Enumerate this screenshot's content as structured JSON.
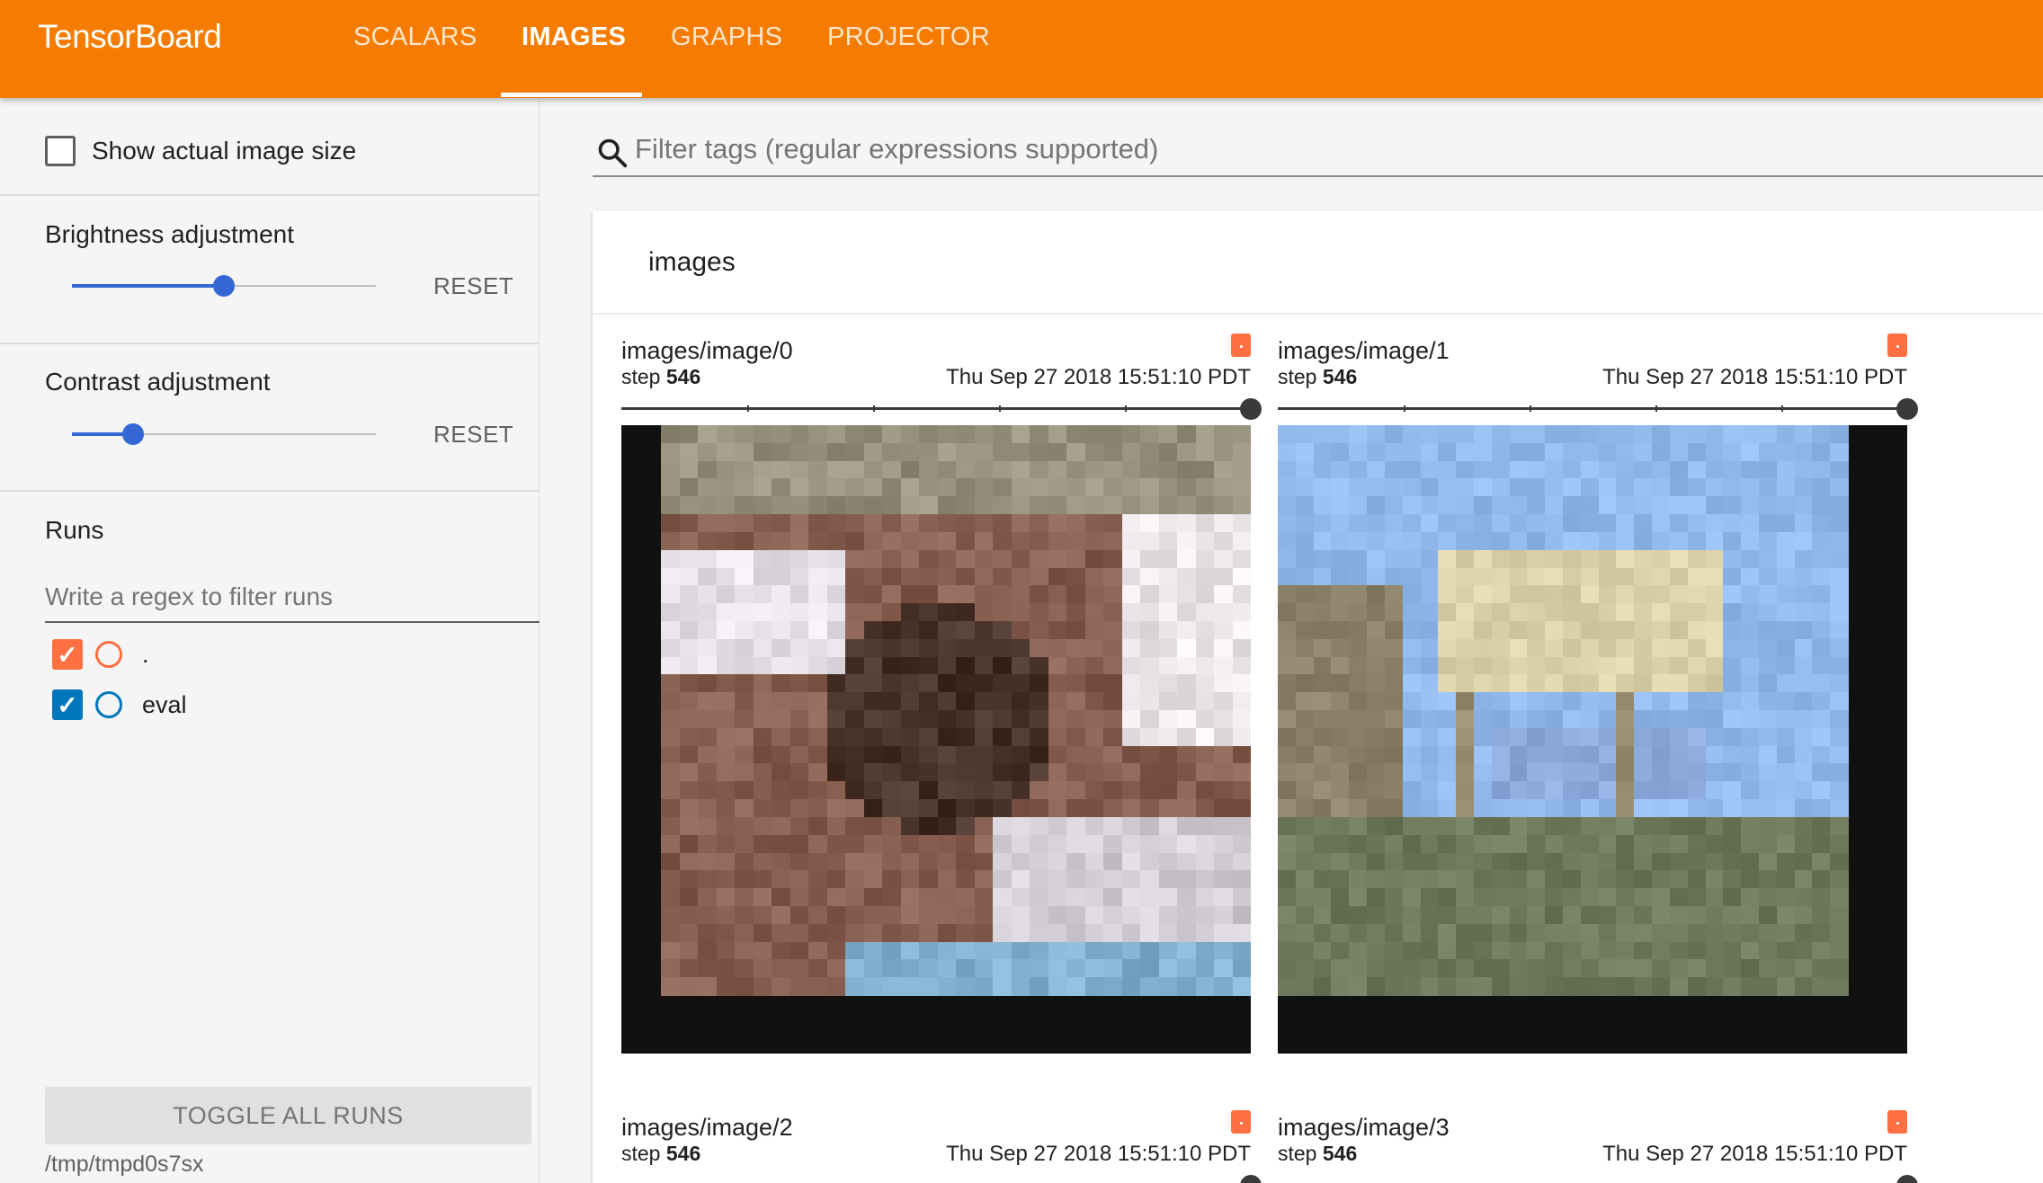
{
  "header": {
    "brand": "TensorBoard",
    "tabs": [
      {
        "label": "SCALARS",
        "active": false
      },
      {
        "label": "IMAGES",
        "active": true
      },
      {
        "label": "GRAPHS",
        "active": false
      },
      {
        "label": "PROJECTOR",
        "active": false
      }
    ],
    "color": "#f57c00"
  },
  "sidebar": {
    "show_actual_size": {
      "label": "Show actual image size",
      "checked": false
    },
    "brightness": {
      "title": "Brightness adjustment",
      "value": 0.5,
      "reset_label": "RESET"
    },
    "contrast": {
      "title": "Contrast adjustment",
      "value": 0.2,
      "reset_label": "RESET"
    },
    "runs": {
      "title": "Runs",
      "filter_placeholder": "Write a regex to filter runs",
      "items": [
        {
          "name": ".",
          "checked": true,
          "color": "#ff7043"
        },
        {
          "name": "eval",
          "checked": true,
          "color": "#0077bb"
        }
      ]
    },
    "toggle_all_label": "TOGGLE ALL RUNS",
    "logdir": "/tmp/tmpd0s7sx"
  },
  "main": {
    "filter_placeholder": "Filter tags (regular expressions supported)",
    "category_title": "images",
    "panels": [
      {
        "tag": "images/image/0",
        "step_label": "step",
        "step": "546",
        "time": "Thu Sep 27 2018 15:51:10 PDT"
      },
      {
        "tag": "images/image/1",
        "step_label": "step",
        "step": "546",
        "time": "Thu Sep 27 2018 15:51:10 PDT"
      },
      {
        "tag": "images/image/2",
        "step_label": "step",
        "step": "546",
        "time": "Thu Sep 27 2018 15:51:10 PDT"
      },
      {
        "tag": "images/image/3",
        "step_label": "step",
        "step": "546",
        "time": "Thu Sep 27 2018 15:51:10 PDT"
      }
    ]
  }
}
